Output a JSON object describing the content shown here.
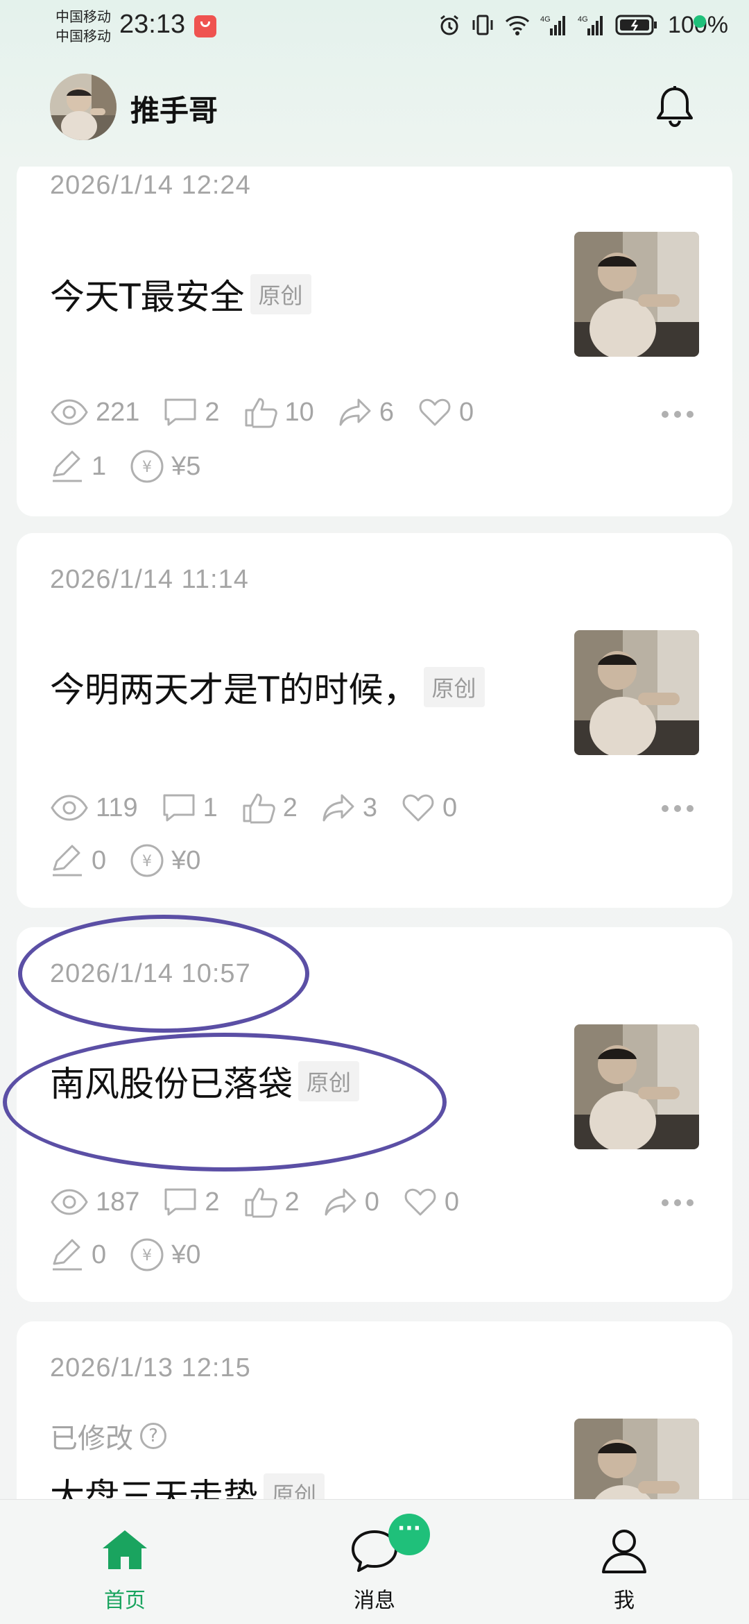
{
  "status_bar": {
    "carrier_1": "中国移动",
    "carrier_2": "中国移动",
    "time": "23:13",
    "battery": "100%"
  },
  "header": {
    "username": "推手哥"
  },
  "colors": {
    "accent": "#1fc07a",
    "annotation": "#5b4fa5"
  },
  "posts": [
    {
      "date": "2026/1/14 12:24",
      "title": "今天T最安全",
      "tag": "原创",
      "views": "221",
      "comments": "2",
      "likes": "10",
      "shares": "6",
      "favorites": "0",
      "edits": "1",
      "reward": "¥5"
    },
    {
      "date": "2026/1/14 11:14",
      "title": "今明两天才是T的时候，",
      "tag": "原创",
      "views": "119",
      "comments": "1",
      "likes": "2",
      "shares": "3",
      "favorites": "0",
      "edits": "0",
      "reward": "¥0"
    },
    {
      "date": "2026/1/14 10:57",
      "title": "南风股份已落袋",
      "tag": "原创",
      "views": "187",
      "comments": "2",
      "likes": "2",
      "shares": "0",
      "favorites": "0",
      "edits": "0",
      "reward": "¥0"
    },
    {
      "date": "2026/1/13 12:15",
      "edited_label": "已修改",
      "title": "大盘三天走势",
      "tag": "原创"
    }
  ],
  "bottom_nav": {
    "home": "首页",
    "messages": "消息",
    "messages_badge": "···",
    "me": "我"
  }
}
